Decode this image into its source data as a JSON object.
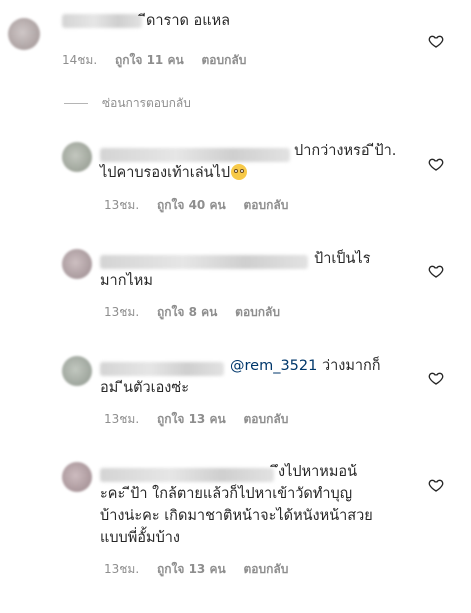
{
  "comments": [
    {
      "lines": [
        "ีดาราด อแหล"
      ],
      "time": "14ชม.",
      "likes": "ถูกใจ 11 คน",
      "reply": "ตอบกลับ"
    },
    {
      "lines": [
        "ปากว่างหรอ ีป้า.",
        "ไปคาบรองเท้าเล่นไป"
      ],
      "time": "13ชม.",
      "likes": "ถูกใจ 40 คน",
      "reply": "ตอบกลับ"
    },
    {
      "lines": [
        "ป้าเป็นไร",
        "มากไหม"
      ],
      "time": "13ชม.",
      "likes": "ถูกใจ 8 คน",
      "reply": "ตอบกลับ"
    },
    {
      "mention": "@rem_3521",
      "lines": [
        "ว่างมากก็",
        "อม ีนตัวเองซ่ะ"
      ],
      "time": "13ชม.",
      "likes": "ถูกใจ 13 คน",
      "reply": "ตอบกลับ"
    },
    {
      "lines": [
        "ึงไปหาหมอน้",
        "ะคะ ีป้า ใกล้ตายแล้วก็ไปหาเข้าวัดทำบุญ",
        "บ้างน่ะคะ เกิดมาชาติหน้าจะได้หนังหน้าสวย",
        "แบบพี่อั้มบ้าง"
      ],
      "time": "13ชม.",
      "likes": "ถูกใจ 13 คน",
      "reply": "ตอบกลับ"
    }
  ],
  "hide_replies_label": "ซ่อนการตอบกลับ",
  "icons": {
    "heart": "heart-outline-icon",
    "emoji": "rolling-eyes-emoji-icon"
  },
  "colors": {
    "text": "#262626",
    "meta": "#8e8e8e",
    "mention": "#00376b"
  }
}
